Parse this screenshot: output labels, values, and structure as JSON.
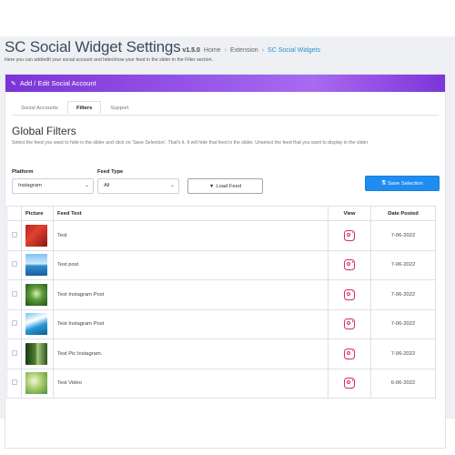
{
  "header": {
    "title": "SC Social Widget Settings",
    "version": "v1.5.0",
    "breadcrumbs": [
      {
        "label": "Home"
      },
      {
        "label": "Extension"
      },
      {
        "label": "SC Social Widgets"
      }
    ],
    "description": "Here you can add/edit your social account and hide/show your feed in the slider in the Filter section."
  },
  "panel": {
    "title": "Add / Edit Social Account",
    "icon": "pencil-icon",
    "accent": "#8a45e0"
  },
  "tabs": [
    {
      "label": "Social Accounts",
      "active": false
    },
    {
      "label": "Filters",
      "active": true
    },
    {
      "label": "Support",
      "active": false
    }
  ],
  "filters": {
    "title": "Global Filters",
    "description": "Select the feed you want to hide in the slider and click on 'Save Selection'. That's it. It will hide that feed in the slider. Unselect the feed that you want to display in the slider.",
    "platform_label": "Platform",
    "platform_value": "Instagram",
    "feed_type_label": "Feed Type",
    "feed_type_value": "All",
    "load_button": "Load Feed",
    "save_button": "Save Selection",
    "save_color": "#1f8cf0"
  },
  "table": {
    "columns": [
      "",
      "Picture",
      "Feed Text",
      "View",
      "Date Posted"
    ],
    "rows": [
      {
        "text": "Test",
        "date": "7-06-2022",
        "thumb": "red-tree"
      },
      {
        "text": "Test post",
        "date": "7-06-2022",
        "thumb": "ocean-sky"
      },
      {
        "text": "Test Instagram Post",
        "date": "7-06-2022",
        "thumb": "green-forest"
      },
      {
        "text": "Test Instagram Post",
        "date": "7-06-2022",
        "thumb": "blue-waterfall"
      },
      {
        "text": "Test Pic Instagram.",
        "date": "7-06-2022",
        "thumb": "forest-path"
      },
      {
        "text": "Test Video",
        "date": "6-06-2022",
        "thumb": "bright-foliage"
      }
    ],
    "view_icon": "instagram-icon"
  }
}
